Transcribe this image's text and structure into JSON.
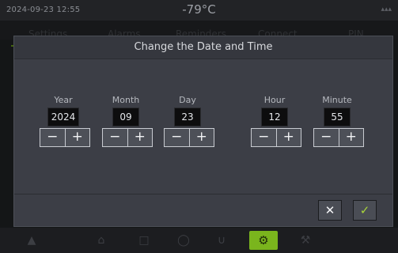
{
  "status": {
    "datetime": "2024-09-23  12:55",
    "temperature": "-79°C",
    "signal": "▴▴▴"
  },
  "tabs": [
    "Settings",
    "Alarms",
    "Reminders",
    "Connect",
    "PIN"
  ],
  "dialog": {
    "title": "Change the Date and Time",
    "fields": [
      {
        "label": "Year",
        "value": "2024"
      },
      {
        "label": "Month",
        "value": "09"
      },
      {
        "label": "Day",
        "value": "23"
      },
      {
        "label": "Hour",
        "value": "12"
      },
      {
        "label": "Minute",
        "value": "55"
      }
    ],
    "decrement": "−",
    "increment": "+",
    "cancel": "✕",
    "confirm": "✓"
  },
  "bottom_nav": {
    "icons": [
      "bell-icon",
      "home-icon",
      "chart-icon",
      "info-icon",
      "door-icon",
      "gear-icon",
      "wrench-icon"
    ],
    "active": "gear-icon"
  },
  "colors": {
    "accent": "#7ab51d",
    "dialog": "#3c3e46",
    "value_box": "#0d0d0e"
  }
}
